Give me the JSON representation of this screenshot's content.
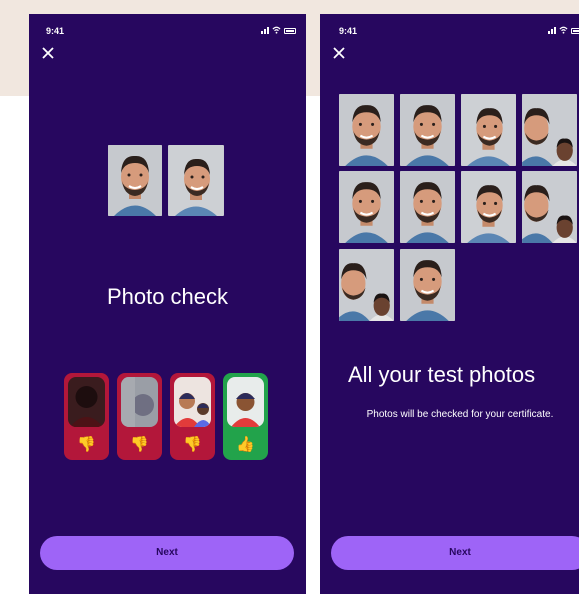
{
  "screen1": {
    "status_time": "9:41",
    "title": "Photo check",
    "next_label": "Next",
    "examples": [
      {
        "verdict": "bad",
        "icon": "thumbs-down-icon",
        "glyph": "👎"
      },
      {
        "verdict": "bad",
        "icon": "thumbs-down-icon",
        "glyph": "👎"
      },
      {
        "verdict": "bad",
        "icon": "thumbs-down-icon",
        "glyph": "👎"
      },
      {
        "verdict": "good",
        "icon": "thumbs-up-icon",
        "glyph": "👍"
      }
    ]
  },
  "screen2": {
    "status_time": "9:41",
    "title": "All your test photos",
    "subtitle": "Photos will be checked for your certificate.",
    "next_label": "Next"
  },
  "colors": {
    "background": "#27075f",
    "accent": "#9e64f7",
    "bad": "#b3173a",
    "good": "#22a34b"
  }
}
